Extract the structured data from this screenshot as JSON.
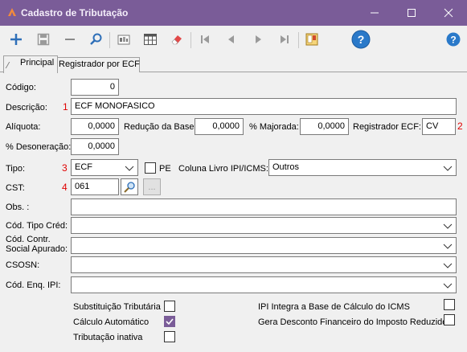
{
  "window": {
    "title": "Cadastro de Tributação"
  },
  "toolbar": {
    "icons": [
      "add-icon",
      "save-icon",
      "remove-icon",
      "search-icon",
      "report-icon",
      "grid-icon",
      "eraser-icon",
      "first-icon",
      "prev-icon",
      "next-icon",
      "last-icon",
      "book-icon",
      "help-icon",
      "help-icon"
    ]
  },
  "tabs": {
    "principal": "Principal",
    "registrador": "Registrador por ECF"
  },
  "form": {
    "codigo": {
      "label": "Código:",
      "value": "0"
    },
    "descricao": {
      "label": "Descrição:",
      "marker": "1",
      "value": "ECF MONOFASICO"
    },
    "aliquota": {
      "label": "Alíquota:",
      "value": "0,0000"
    },
    "reducao": {
      "label": "Redução da Base:",
      "value": "0,0000"
    },
    "majorada": {
      "label": "% Majorada:",
      "value": "0,0000"
    },
    "registrador": {
      "label": "Registrador ECF:",
      "value": "CV",
      "marker": "2"
    },
    "desoneracao": {
      "label": "% Desoneração:",
      "value": "0,0000"
    },
    "tipo": {
      "label": "Tipo:",
      "marker": "3",
      "value": "ECF"
    },
    "pe": {
      "label": "PE"
    },
    "coluna": {
      "label": "Coluna Livro IPI/ICMS:",
      "value": "Outros"
    },
    "cst": {
      "label": "CST:",
      "marker": "4",
      "value": "061",
      "ellipsis": "..."
    },
    "obs": {
      "label": "Obs. :",
      "value": ""
    },
    "cod_tipo_cred": {
      "label": "Cód. Tipo Créd:",
      "value": ""
    },
    "cod_contr": {
      "label1": "Cód. Contr.",
      "label2": "Social Apurado:",
      "value": ""
    },
    "csosn": {
      "label": "CSOSN:",
      "value": ""
    },
    "cod_enq_ipi": {
      "label": "Cód. Enq. IPI:",
      "value": ""
    }
  },
  "checks": {
    "subst": {
      "label": "Substituição Tributária",
      "checked": false
    },
    "calculo": {
      "label": "Cálculo Automático",
      "checked": true
    },
    "inativa": {
      "label": "Tributação inativa",
      "checked": false
    },
    "ipi_integra": {
      "label": "IPI Integra a Base de Cálculo do ICMS",
      "checked": false
    },
    "gera_desconto": {
      "label": "Gera Desconto Financeiro do Imposto Reduzido",
      "checked": false
    }
  },
  "colors": {
    "titlebar": "#7a5c98",
    "accent": "#7a5c98",
    "required": "#e00000"
  }
}
